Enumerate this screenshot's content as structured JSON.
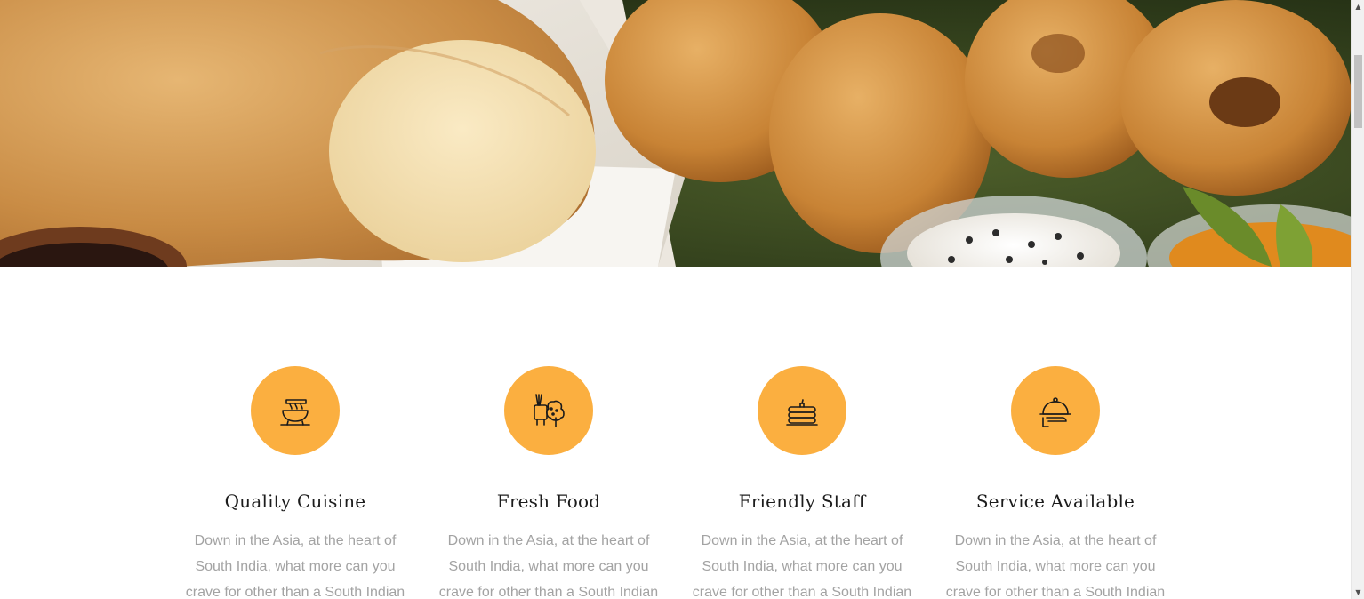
{
  "hero": {
    "image_description_icon": "food-photo"
  },
  "features": [
    {
      "icon": "soup-bowl-icon",
      "title": "Quality Cuisine",
      "lines": [
        "Down in the Asia, at the heart of",
        "South India, what more can you",
        "crave for other than a South Indian"
      ]
    },
    {
      "icon": "fresh-food-icon",
      "title": "Fresh Food",
      "lines": [
        "Down in the Asia, at the heart of",
        "South India, what more can you",
        "crave for other than a South Indian"
      ]
    },
    {
      "icon": "pancake-stack-icon",
      "title": "Friendly Staff",
      "lines": [
        "Down in the Asia, at the heart of",
        "South India, what more can you",
        "crave for other than a South Indian"
      ]
    },
    {
      "icon": "serving-cloche-icon",
      "title": "Service Available",
      "lines": [
        "Down in the Asia, at the heart of",
        "South India, what more can you",
        "crave for other than a South Indian"
      ]
    }
  ],
  "colors": {
    "accent": "#fbaf40",
    "title": "#1c1c1c",
    "text": "#a3a3a3"
  },
  "scrollbar": {
    "up": "▲",
    "down": "▼"
  }
}
